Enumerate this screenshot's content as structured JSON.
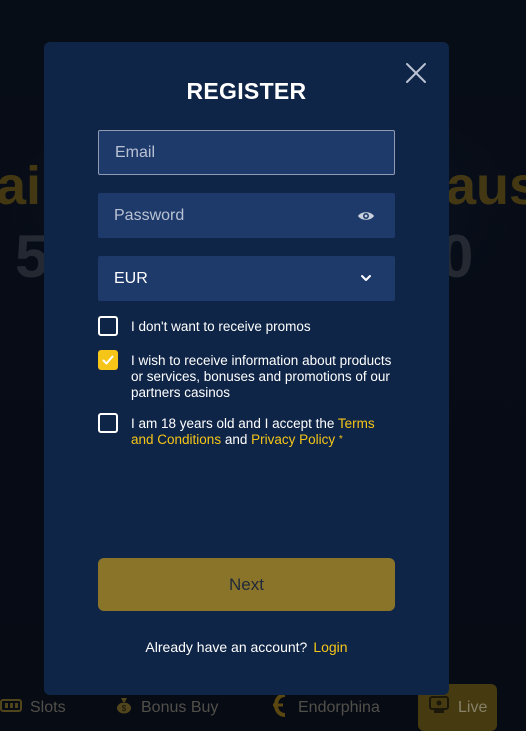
{
  "background": {
    "headline_left": "ai",
    "headline_right": "aus",
    "sub_left": "5",
    "sub_right": "0",
    "nav": [
      {
        "label": "Slots",
        "icon": "slot-machine-icon"
      },
      {
        "label": "Bonus Buy",
        "icon": "money-bag-icon"
      },
      {
        "label": "Endorphina",
        "icon": "endorphina-logo-icon"
      },
      {
        "label": "Live",
        "icon": "live-dealer-icon"
      }
    ]
  },
  "modal": {
    "title": "REGISTER",
    "close_icon": "close-icon",
    "email": {
      "placeholder": "Email",
      "value": ""
    },
    "password": {
      "placeholder": "Password",
      "value": "",
      "icon": "eye-icon"
    },
    "currency": {
      "value": "EUR",
      "icon": "chevron-down-icon"
    },
    "checkboxes": {
      "no_promos": {
        "label": "I don't want to receive promos",
        "checked": false
      },
      "partner_info": {
        "label": "I wish to receive information about products or services, bonuses and promotions of our partners casinos",
        "checked": true
      },
      "terms": {
        "prefix": "I am 18 years old and I accept the ",
        "terms_link": "Terms and Conditions",
        "and": " and ",
        "privacy_link": "Privacy Policy",
        "required_mark": "*",
        "checked": false
      }
    },
    "next_label": "Next",
    "footer": {
      "text": "Already have an account?",
      "login_link": "Login"
    }
  },
  "colors": {
    "modal_bg": "#0f2547",
    "field_bg": "#1e3a6b",
    "accent": "#f5c518",
    "button_disabled": "#8a742a"
  }
}
